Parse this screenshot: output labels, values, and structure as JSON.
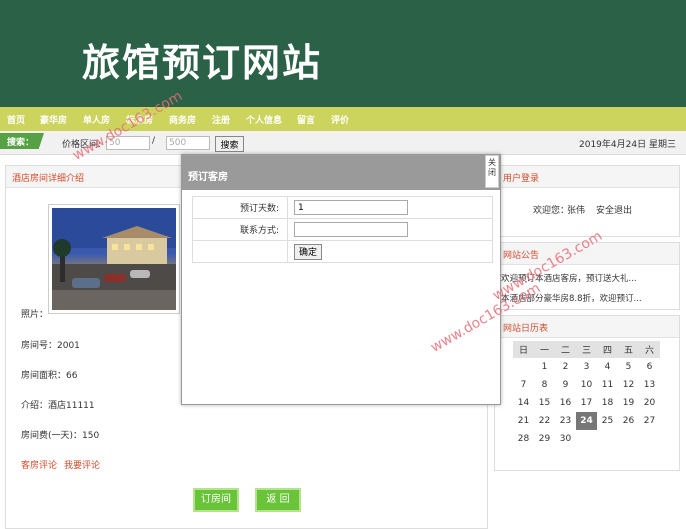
{
  "header": {
    "title": "旅馆预订网站"
  },
  "nav": {
    "items": [
      {
        "label": "首页"
      },
      {
        "label": "豪华房"
      },
      {
        "label": "单人房"
      },
      {
        "label": "标准房"
      },
      {
        "label": "商务房"
      },
      {
        "label": "注册"
      },
      {
        "label": "个人信息"
      },
      {
        "label": "留言"
      },
      {
        "label": "评价"
      }
    ]
  },
  "search": {
    "tag": "搜索：",
    "price_label": "价格区间:",
    "min_value": "50",
    "separator": "/",
    "max_value": "500",
    "button": "搜索"
  },
  "date": "2019年4月24日 星期三",
  "room_panel": {
    "title": "酒店房间详细介绍",
    "photo_label": "照片：",
    "room_no": "房间号：2001",
    "area": "房间面积：66",
    "intro": "介绍：酒店11111",
    "fee": "房间费(一天)：150",
    "link_reviews": "客房评论",
    "link_write_review": "我要评论",
    "book_button": "订房间",
    "back_button": "返 回"
  },
  "modal": {
    "title": "预订客房",
    "close_label": "关闭",
    "days_label": "预订天数:",
    "days_value": "1",
    "contact_label": "联系方式:",
    "contact_value": "",
    "confirm_button": "确定"
  },
  "user_panel": {
    "title": "用户登录",
    "welcome": "欢迎您：",
    "username": "张伟",
    "logout": "安全退出"
  },
  "notice_panel": {
    "title": "网站公告",
    "items": [
      {
        "text": "欢迎预订本酒店客房，预订送大礼..."
      },
      {
        "text": "本酒店部分豪华房8.8折，欢迎预订..."
      }
    ]
  },
  "calendar": {
    "title": "网站日历表",
    "weekdays": [
      "日",
      "一",
      "二",
      "三",
      "四",
      "五",
      "六"
    ],
    "weeks": [
      [
        "",
        "1",
        "2",
        "3",
        "4",
        "5",
        "6"
      ],
      [
        "7",
        "8",
        "9",
        "10",
        "11",
        "12",
        "13"
      ],
      [
        "14",
        "15",
        "16",
        "17",
        "18",
        "19",
        "20"
      ],
      [
        "21",
        "22",
        "23",
        "24",
        "25",
        "26",
        "27"
      ],
      [
        "28",
        "29",
        "30",
        "",
        "",
        "",
        ""
      ]
    ],
    "today": "24"
  },
  "watermark": {
    "text_1": "www.doc163.com",
    "text_2": "www.doc163.com",
    "text_3": "www.doc163.com"
  },
  "colors": {
    "header_bg": "#2a6147",
    "nav_bg": "#cdd45e",
    "accent_red": "#d34b2c",
    "button_green": "#6ac43a",
    "watermark": "#e86d77"
  }
}
